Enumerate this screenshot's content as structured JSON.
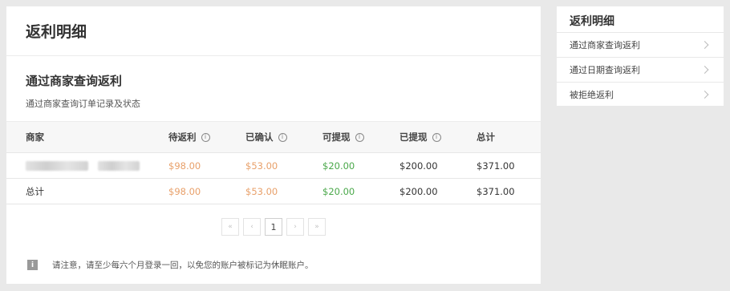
{
  "main": {
    "title": "返利明细",
    "section_title": "通过商家查询返利",
    "section_desc": "通过商家查询订单记录及状态"
  },
  "table": {
    "headers": [
      "商家",
      "待返利",
      "已确认",
      "可提现",
      "已提现",
      "总计"
    ],
    "info_icon": "info-circle-icon",
    "rows": [
      {
        "merchant": "",
        "pending": "$98.00",
        "confirmed": "$53.00",
        "withdrawable": "$20.00",
        "withdrawn": "$200.00",
        "total": "$371.00"
      }
    ],
    "total_row": {
      "label": "总计",
      "pending": "$98.00",
      "confirmed": "$53.00",
      "withdrawable": "$20.00",
      "withdrawn": "$200.00",
      "total": "$371.00"
    },
    "colors": {
      "pending": "#e8a06a",
      "confirmed": "#e8a06a",
      "withdrawable": "#4aa84a",
      "withdrawn": "#333333",
      "total": "#333333"
    }
  },
  "pagination": {
    "first": "«",
    "prev": "‹",
    "current": "1",
    "next": "›",
    "last": "»"
  },
  "notice": {
    "icon": "i",
    "text": "请注意，请至少每六个月登录一回，以免您的账户被标记为休眠账户。"
  },
  "sidebar": {
    "title": "返利明细",
    "items": [
      {
        "label": "通过商家查询返利"
      },
      {
        "label": "通过日期查询返利"
      },
      {
        "label": "被拒绝返利"
      }
    ]
  }
}
